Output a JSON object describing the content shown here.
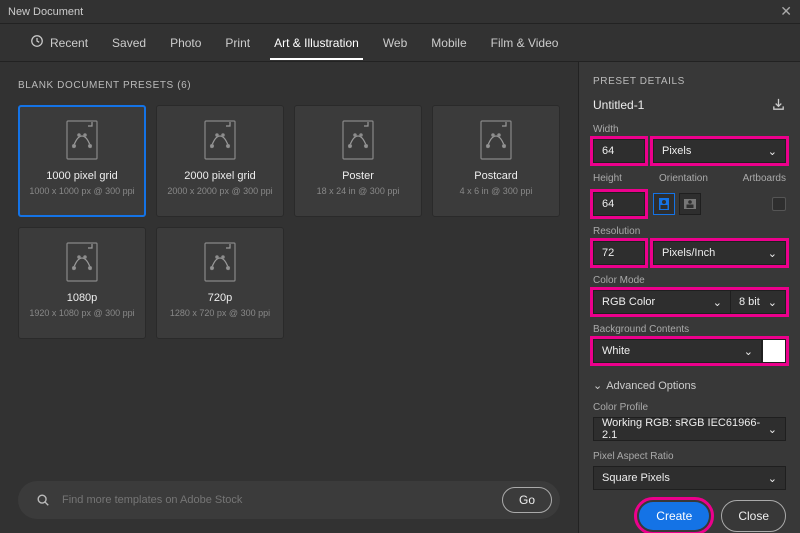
{
  "window": {
    "title": "New Document"
  },
  "tabs": {
    "recent": "Recent",
    "saved": "Saved",
    "photo": "Photo",
    "print": "Print",
    "art": "Art & Illustration",
    "web": "Web",
    "mobile": "Mobile",
    "film": "Film & Video",
    "active": "art"
  },
  "presets": {
    "header": "BLANK DOCUMENT PRESETS",
    "count": "(6)",
    "items": [
      {
        "name": "1000 pixel grid",
        "sub": "1000 x 1000 px @ 300 ppi",
        "selected": true
      },
      {
        "name": "2000 pixel grid",
        "sub": "2000 x 2000 px @ 300 ppi",
        "selected": false
      },
      {
        "name": "Poster",
        "sub": "18 x 24 in @ 300 ppi",
        "selected": false
      },
      {
        "name": "Postcard",
        "sub": "4 x 6 in @ 300 ppi",
        "selected": false
      },
      {
        "name": "1080p",
        "sub": "1920 x 1080 px @ 300 ppi",
        "selected": false
      },
      {
        "name": "720p",
        "sub": "1280 x 720 px @ 300 ppi",
        "selected": false
      }
    ]
  },
  "search": {
    "placeholder": "Find more templates on Adobe Stock",
    "go": "Go"
  },
  "details": {
    "title": "PRESET DETAILS",
    "doc_name": "Untitled-1",
    "width_label": "Width",
    "width": "64",
    "width_unit": "Pixels",
    "height_label": "Height",
    "height": "64",
    "orientation_label": "Orientation",
    "artboards_label": "Artboards",
    "orientation": "portrait",
    "artboards": false,
    "resolution_label": "Resolution",
    "resolution": "72",
    "resolution_unit": "Pixels/Inch",
    "color_mode_label": "Color Mode",
    "color_mode": "RGB Color",
    "color_depth": "8 bit",
    "bg_label": "Background Contents",
    "bg": "White",
    "bg_swatch": "#ffffff",
    "advanced": "Advanced Options",
    "profile_label": "Color Profile",
    "profile": "Working RGB: sRGB IEC61966-2.1",
    "par_label": "Pixel Aspect Ratio",
    "par": "Square Pixels"
  },
  "footer": {
    "create": "Create",
    "close": "Close"
  }
}
